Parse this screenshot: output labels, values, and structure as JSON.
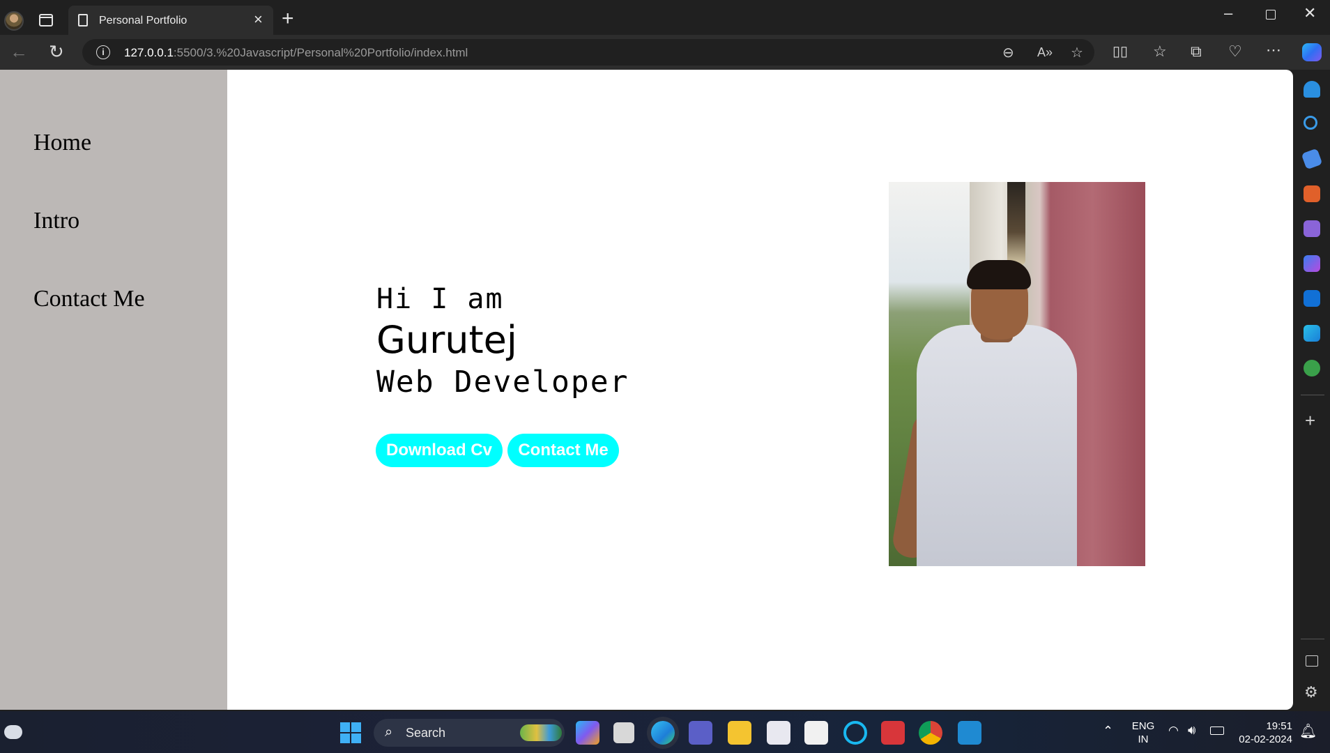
{
  "browser": {
    "tab_title": "Personal Portfolio",
    "url_host": "127.0.0.1",
    "url_rest": ":5500/3.%20Javascript/Personal%20Portfolio/index.html"
  },
  "nav": {
    "items": [
      {
        "label": "Home"
      },
      {
        "label": "Intro"
      },
      {
        "label": "Contact Me"
      }
    ]
  },
  "hero": {
    "greeting": "Hi I am",
    "name": "Gurutej",
    "role": "Web Developer",
    "download_button": "Download Cv",
    "contact_button": "Contact Me",
    "accent_color": "#00ffff"
  },
  "taskbar": {
    "search_placeholder": "Search",
    "lang_line1": "ENG",
    "lang_line2": "IN",
    "time": "19:51",
    "date": "02-02-2024"
  },
  "colors": {
    "sidebar_bg": "#bcb8b6",
    "page_bg": "#ffffff",
    "chrome_bg": "#202020"
  }
}
